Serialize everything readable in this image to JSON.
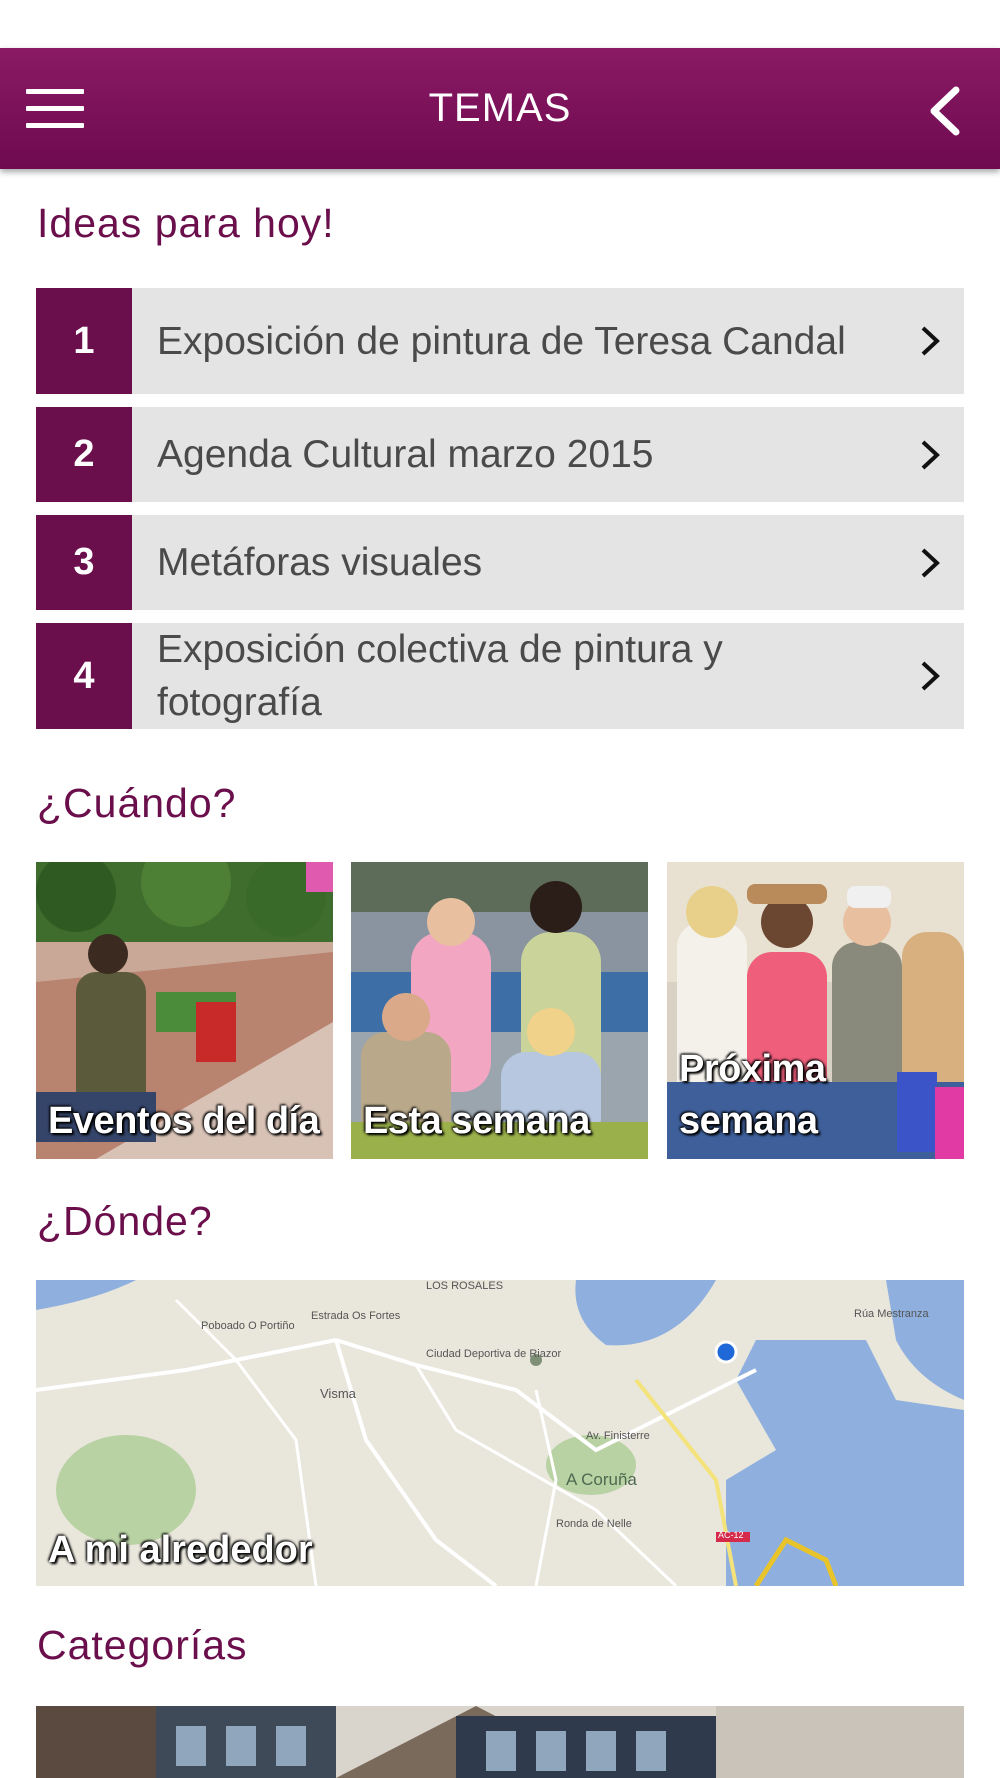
{
  "header": {
    "title": "TEMAS"
  },
  "ideas": {
    "title": "Ideas para hoy!",
    "items": [
      {
        "number": "1",
        "label": "Exposición de pintura de Teresa Candal"
      },
      {
        "number": "2",
        "label": "Agenda Cultural marzo 2015"
      },
      {
        "number": "3",
        "label": "Metáforas visuales"
      },
      {
        "number": "4",
        "label": "Exposición colectiva de pintura y fotografía"
      }
    ]
  },
  "cuando": {
    "title": "¿Cuándo?",
    "tiles": [
      {
        "label": "Eventos del día"
      },
      {
        "label": "Esta semana"
      },
      {
        "label": "Próxima semana"
      }
    ]
  },
  "donde": {
    "title": "¿Dónde?",
    "map_label": "A mi alrededor",
    "map_places": [
      "LOS ROSALES",
      "Ciudad Deportiva de Riazor",
      "Visma",
      "A Coruña",
      "Poboado O Portiño",
      "Estrada Os Fortes",
      "Rúa Mestranza",
      "Ronda de Nelle",
      "Av. Finisterre",
      "AC-12"
    ]
  },
  "categorias": {
    "title": "Categorías"
  },
  "colors": {
    "brand": "#6b0e4c",
    "row_bg": "#e4e4e4"
  }
}
